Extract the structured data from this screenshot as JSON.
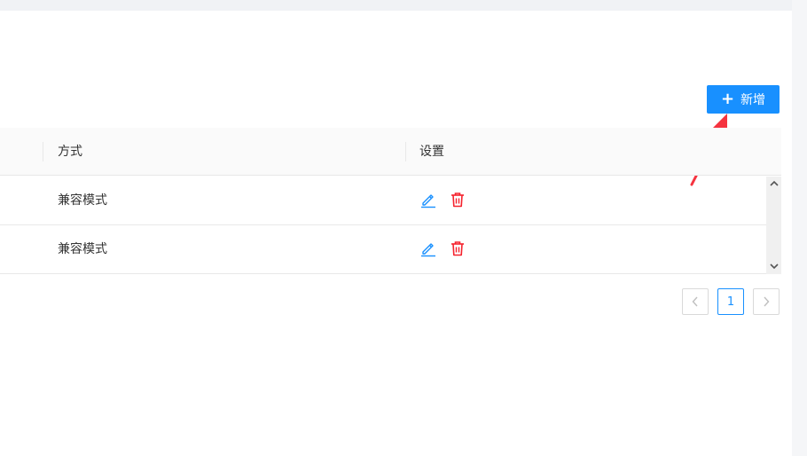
{
  "toolbar": {
    "add_label": "新增"
  },
  "table": {
    "columns": [
      "方式",
      "设置"
    ],
    "rows": [
      {
        "mode": "兼容模式"
      },
      {
        "mode": "兼容模式"
      }
    ]
  },
  "pagination": {
    "current_page": "1"
  },
  "colors": {
    "primary": "#1890ff",
    "danger": "#f5222d",
    "annotation": "#f5333f"
  },
  "icons": [
    "plus-icon",
    "edit-icon",
    "delete-icon",
    "chevron-up-icon",
    "chevron-down-icon",
    "chevron-left-icon",
    "chevron-right-icon"
  ]
}
